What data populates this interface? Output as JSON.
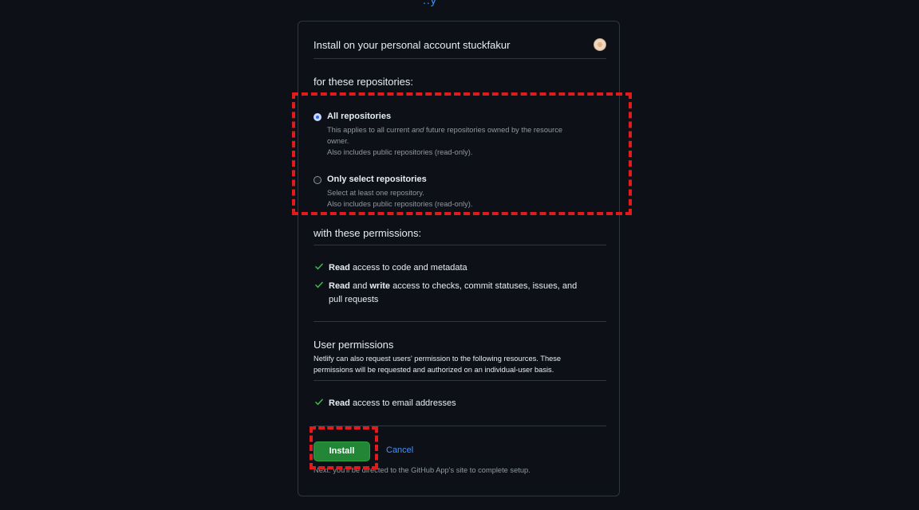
{
  "header": {
    "title_fragment": "..y"
  },
  "account": {
    "label": "Install on your personal account stuckfakur",
    "avatar": "user-avatar"
  },
  "repositories": {
    "heading": "for these repositories:",
    "selected": "all",
    "options": [
      {
        "title": "All repositories",
        "desc_line1_pre": "This applies to all current ",
        "desc_line1_em": "and",
        "desc_line1_post": " future repositories owned by the resource",
        "desc_line2": "owner.",
        "desc_line3": "Also includes public repositories (read-only)."
      },
      {
        "title": "Only select repositories",
        "desc_line1": "Select at least one repository.",
        "desc_line2": "Also includes public repositories (read-only)."
      }
    ]
  },
  "permissions": {
    "heading": "with these permissions:",
    "items": [
      {
        "strong1": "Read",
        "text1": " access to code and metadata"
      },
      {
        "strong1": "Read",
        "mid": " and ",
        "strong2": "write",
        "text2_line1": " access to checks, commit statuses, issues, and",
        "text2_line2": "pull requests"
      }
    ]
  },
  "user_permissions": {
    "heading": "User permissions",
    "desc_line1": "Netlify can also request users' permission to the following resources. These",
    "desc_line2": "permissions will be requested and authorized on an individual-user basis.",
    "items": [
      {
        "strong": "Read",
        "text": " access to email addresses"
      }
    ]
  },
  "actions": {
    "install_label": "Install",
    "cancel_label": "Cancel",
    "next_note": "Next: you'll be directed to the GitHub App's site to complete setup."
  },
  "colors": {
    "background": "#0d1117",
    "border": "#30363d",
    "accent_link": "#4493f8",
    "install_green": "#238636",
    "check_green": "#3fb950",
    "highlight_red": "#e01b1b"
  }
}
